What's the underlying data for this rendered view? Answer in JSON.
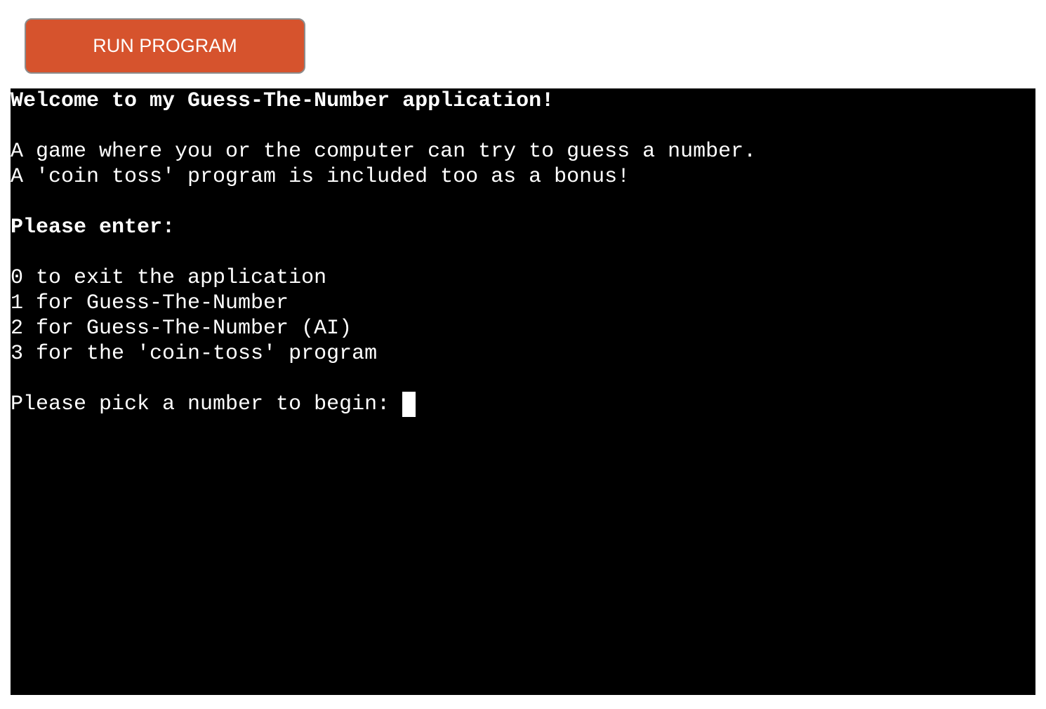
{
  "toolbar": {
    "run_label": "RUN PROGRAM"
  },
  "terminal": {
    "lines": [
      {
        "text": "Welcome to my Guess-The-Number application!",
        "bold": true
      },
      {
        "text": "",
        "bold": false
      },
      {
        "text": "A game where you or the computer can try to guess a number.",
        "bold": false
      },
      {
        "text": "A 'coin toss' program is included too as a bonus!",
        "bold": false
      },
      {
        "text": "",
        "bold": false
      },
      {
        "text": "Please enter:",
        "bold": true
      },
      {
        "text": "",
        "bold": false
      },
      {
        "text": "0 to exit the application",
        "bold": false
      },
      {
        "text": "1 for Guess-The-Number",
        "bold": false
      },
      {
        "text": "2 for Guess-The-Number (AI)",
        "bold": false
      },
      {
        "text": "3 for the 'coin-toss' program",
        "bold": false
      },
      {
        "text": "",
        "bold": false
      }
    ],
    "prompt": "Please pick a number to begin: ",
    "input_value": ""
  },
  "colors": {
    "button_bg": "#d6532d",
    "terminal_bg": "#000000",
    "terminal_fg": "#ffffff"
  }
}
